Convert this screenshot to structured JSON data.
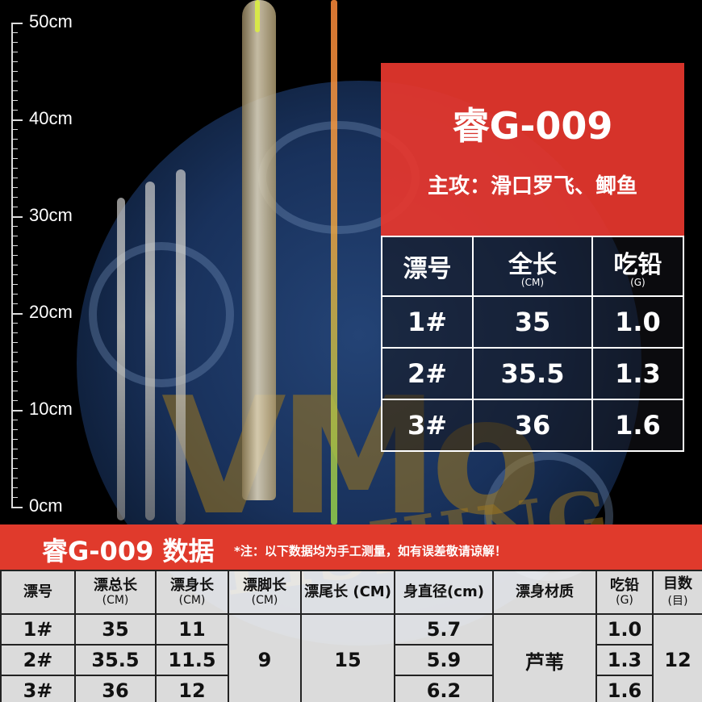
{
  "ruler": {
    "labels": [
      "50cm",
      "40cm",
      "30cm",
      "20cm",
      "10cm",
      "0cm"
    ]
  },
  "title": {
    "model": "睿G-009",
    "target": "主攻：滑口罗飞、鲫鱼"
  },
  "spec_table": {
    "headers": [
      {
        "label": "漂号",
        "unit": ""
      },
      {
        "label": "全长",
        "unit": "(CM)"
      },
      {
        "label": "吃铅",
        "unit": "(G)"
      }
    ],
    "rows": [
      [
        "1#",
        "35",
        "1.0"
      ],
      [
        "2#",
        "35.5",
        "1.3"
      ],
      [
        "3#",
        "36",
        "1.6"
      ]
    ]
  },
  "band": {
    "title": "睿G-009 数据",
    "note": "*注：以下数据均为手工测量，如有误差敬请谅解！"
  },
  "data_table": {
    "headers": [
      {
        "label": "漂号",
        "unit": ""
      },
      {
        "label": "漂总长",
        "unit": "(CM)"
      },
      {
        "label": "漂身长",
        "unit": "(CM)"
      },
      {
        "label": "漂脚长",
        "unit": "(CM)"
      },
      {
        "label": "漂尾长 (CM)",
        "unit": ""
      },
      {
        "label": "身直径(cm)",
        "unit": ""
      },
      {
        "label": "漂身材质",
        "unit": ""
      },
      {
        "label": "吃铅",
        "unit": "(G)"
      },
      {
        "label": "目数",
        "unit": "(目)"
      }
    ],
    "rows": [
      {
        "no": "1#",
        "total": "35",
        "body": "11",
        "diameter": "5.7",
        "lead": "1.0"
      },
      {
        "no": "2#",
        "total": "35.5",
        "body": "11.5",
        "diameter": "5.9",
        "lead": "1.3"
      },
      {
        "no": "3#",
        "total": "36",
        "body": "12",
        "diameter": "6.2",
        "lead": "1.6"
      }
    ],
    "shared": {
      "foot": "9",
      "tail": "15",
      "material": "芦苇",
      "mesh": "12"
    }
  },
  "watermark": {
    "brand": "VMo",
    "sub": "FISHING"
  },
  "colors": {
    "accent_red": "#e03a2c",
    "title_red": "#e6372d"
  }
}
